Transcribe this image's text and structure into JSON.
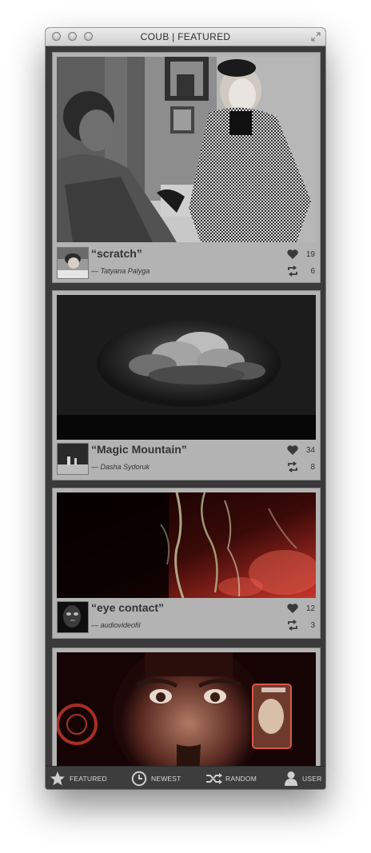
{
  "window": {
    "title": "COUB | FEATURED",
    "controls": [
      "close-icon",
      "minimize-icon",
      "zoom-icon"
    ],
    "resize_icon": "fullscreen-arrows-icon"
  },
  "feed": [
    {
      "title": "“scratch”",
      "author": "— Tatyana Palyga",
      "likes": "19",
      "recoubs": "6"
    },
    {
      "title": "“Magic Mountain”",
      "author": "— Dasha Sydoruk",
      "likes": "34",
      "recoubs": "8"
    },
    {
      "title": "“eye contact”",
      "author": "— audiovideofil",
      "likes": "12",
      "recoubs": "3"
    },
    {
      "title": "",
      "author": "",
      "likes": "",
      "recoubs": ""
    }
  ],
  "tabs": [
    {
      "label": "FEATURED",
      "icon": "star-icon"
    },
    {
      "label": "NEWEST",
      "icon": "clock-icon"
    },
    {
      "label": "RANDOM",
      "icon": "shuffle-icon"
    },
    {
      "label": "USER",
      "icon": "user-icon"
    }
  ],
  "colors": {
    "window_bg": "#3a3a3a",
    "card_bg": "#b3b3b3",
    "tabbar_bg": "#3d3d3d",
    "text_dark": "#333333"
  }
}
